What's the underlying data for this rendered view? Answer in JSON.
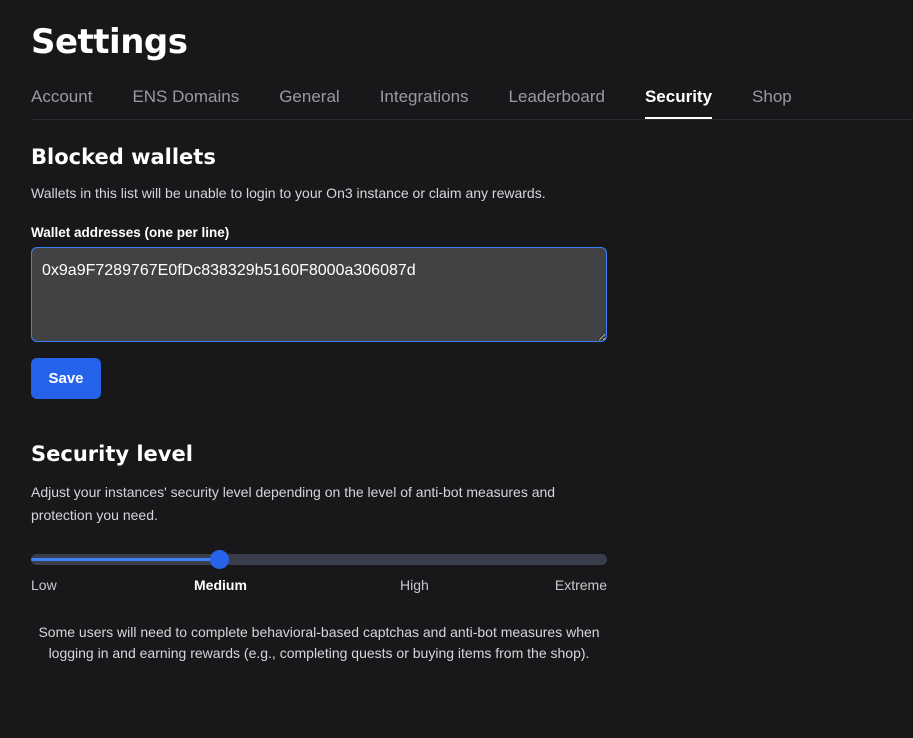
{
  "page": {
    "title": "Settings"
  },
  "tabs": [
    {
      "label": "Account",
      "active": false
    },
    {
      "label": "ENS Domains",
      "active": false
    },
    {
      "label": "General",
      "active": false
    },
    {
      "label": "Integrations",
      "active": false
    },
    {
      "label": "Leaderboard",
      "active": false
    },
    {
      "label": "Security",
      "active": true
    },
    {
      "label": "Shop",
      "active": false
    }
  ],
  "blocked_wallets": {
    "title": "Blocked wallets",
    "description": "Wallets in this list will be unable to login to your On3 instance or claim any rewards.",
    "field_label": "Wallet addresses (one per line)",
    "value": "0x9a9F7289767E0fDc838329b5160F8000a306087d",
    "save_label": "Save"
  },
  "security_level": {
    "title": "Security level",
    "description": "Adjust your instances' security level depending on the level of anti-bot measures and protection you need.",
    "levels": [
      "Low",
      "Medium",
      "High",
      "Extreme"
    ],
    "selected_index": 1,
    "selected_label": "Medium",
    "slider_fraction": 0.3333,
    "note": "Some users will need to complete behavioral-based captchas and anti-bot measures when logging in and earning rewards (e.g., completing quests or buying items from the shop)."
  },
  "colors": {
    "background": "#18181a",
    "accent": "#2563eb",
    "track": "#3a3d4c",
    "input_bg": "#424244"
  }
}
